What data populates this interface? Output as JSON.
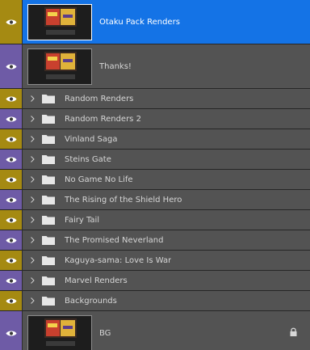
{
  "colors": {
    "eye_purple": "#6e5ba6",
    "eye_gold": "#a58a12",
    "selected": "#1473e6",
    "panel_bg": "#535353"
  },
  "layers": [
    {
      "name": "Otaku Pack Renders",
      "type": "smart-object",
      "eye_color": "#a58a12",
      "selected": true,
      "icons": [
        "eye-icon",
        "thumbnail"
      ]
    },
    {
      "name": "Thanks!",
      "type": "smart-object",
      "eye_color": "#6e5ba6",
      "selected": false,
      "icons": [
        "eye-icon",
        "thumbnail"
      ]
    },
    {
      "name": "Random Renders",
      "type": "group",
      "eye_color": "#a58a12",
      "icons": [
        "eye-icon",
        "chevron-right-icon",
        "folder-icon"
      ]
    },
    {
      "name": "Random Renders 2",
      "type": "group",
      "eye_color": "#6e5ba6",
      "icons": [
        "eye-icon",
        "chevron-right-icon",
        "folder-icon"
      ]
    },
    {
      "name": "Vinland Saga",
      "type": "group",
      "eye_color": "#a58a12",
      "icons": [
        "eye-icon",
        "chevron-right-icon",
        "folder-icon"
      ]
    },
    {
      "name": "Steins Gate",
      "type": "group",
      "eye_color": "#6e5ba6",
      "icons": [
        "eye-icon",
        "chevron-right-icon",
        "folder-icon"
      ]
    },
    {
      "name": "No Game No Life",
      "type": "group",
      "eye_color": "#a58a12",
      "icons": [
        "eye-icon",
        "chevron-right-icon",
        "folder-icon"
      ]
    },
    {
      "name": "The Rising of the Shield Hero",
      "type": "group",
      "eye_color": "#6e5ba6",
      "icons": [
        "eye-icon",
        "chevron-right-icon",
        "folder-icon"
      ]
    },
    {
      "name": "Fairy Tail",
      "type": "group",
      "eye_color": "#a58a12",
      "icons": [
        "eye-icon",
        "chevron-right-icon",
        "folder-icon"
      ]
    },
    {
      "name": "The Promised Neverland",
      "type": "group",
      "eye_color": "#6e5ba6",
      "icons": [
        "eye-icon",
        "chevron-right-icon",
        "folder-icon"
      ]
    },
    {
      "name": "Kaguya-sama: Love Is War",
      "type": "group",
      "eye_color": "#a58a12",
      "icons": [
        "eye-icon",
        "chevron-right-icon",
        "folder-icon"
      ]
    },
    {
      "name": "Marvel Renders",
      "type": "group",
      "eye_color": "#6e5ba6",
      "icons": [
        "eye-icon",
        "chevron-right-icon",
        "folder-icon"
      ]
    },
    {
      "name": "Backgrounds",
      "type": "group",
      "eye_color": "#a58a12",
      "icons": [
        "eye-icon",
        "chevron-right-icon",
        "folder-icon"
      ]
    },
    {
      "name": "BG",
      "type": "background",
      "eye_color": "#6e5ba6",
      "locked": true,
      "icons": [
        "eye-icon",
        "thumbnail",
        "lock-icon"
      ]
    }
  ]
}
